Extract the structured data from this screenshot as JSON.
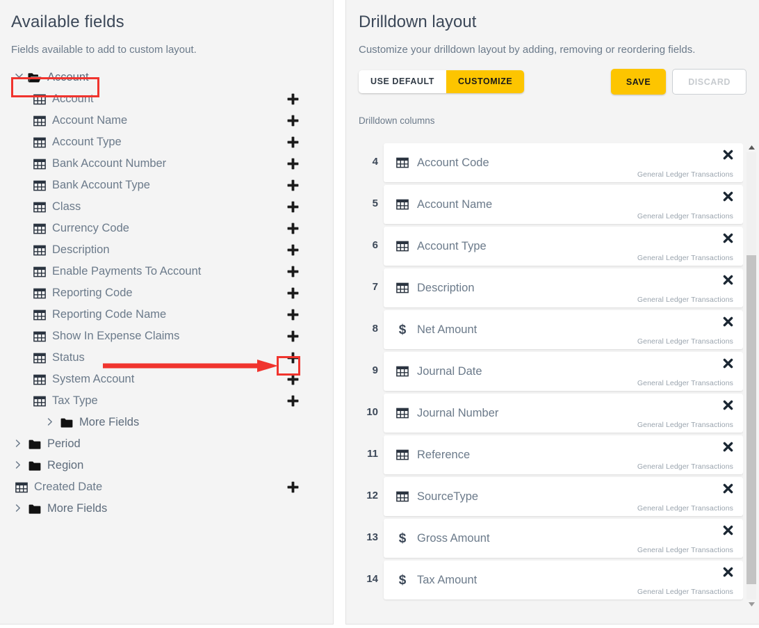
{
  "left": {
    "title": "Available fields",
    "subtitle": "Fields available to add to custom layout.",
    "tree": [
      {
        "label": "Account",
        "type": "folder-open",
        "indent": 0,
        "expanded": true,
        "add": false,
        "highlight": true
      },
      {
        "label": "Account",
        "type": "field",
        "indent": 1,
        "add": true
      },
      {
        "label": "Account Name",
        "type": "field",
        "indent": 1,
        "add": true
      },
      {
        "label": "Account Type",
        "type": "field",
        "indent": 1,
        "add": true
      },
      {
        "label": "Bank Account Number",
        "type": "field",
        "indent": 1,
        "add": true
      },
      {
        "label": "Bank Account Type",
        "type": "field",
        "indent": 1,
        "add": true
      },
      {
        "label": "Class",
        "type": "field",
        "indent": 1,
        "add": true
      },
      {
        "label": "Currency Code",
        "type": "field",
        "indent": 1,
        "add": true
      },
      {
        "label": "Description",
        "type": "field",
        "indent": 1,
        "add": true
      },
      {
        "label": "Enable Payments To Account",
        "type": "field",
        "indent": 1,
        "add": true
      },
      {
        "label": "Reporting Code",
        "type": "field",
        "indent": 1,
        "add": true
      },
      {
        "label": "Reporting Code Name",
        "type": "field",
        "indent": 1,
        "add": true
      },
      {
        "label": "Show In Expense Claims",
        "type": "field",
        "indent": 1,
        "add": true
      },
      {
        "label": "Status",
        "type": "field",
        "indent": 1,
        "add": true,
        "arrow": true
      },
      {
        "label": "System Account",
        "type": "field",
        "indent": 1,
        "add": true
      },
      {
        "label": "Tax Type",
        "type": "field",
        "indent": 1,
        "add": true
      },
      {
        "label": "More Fields",
        "type": "folder-closed",
        "indent": 2,
        "expanded": false,
        "add": false
      },
      {
        "label": "Period",
        "type": "folder-closed",
        "indent": 0,
        "expanded": false,
        "add": false
      },
      {
        "label": "Region",
        "type": "folder-closed",
        "indent": 0,
        "expanded": false,
        "add": false
      },
      {
        "label": "Created Date",
        "type": "field",
        "indent": 0,
        "add": true
      },
      {
        "label": "More Fields",
        "type": "folder-closed",
        "indent": 0,
        "expanded": false,
        "add": false
      }
    ]
  },
  "right": {
    "title": "Drilldown layout",
    "subtitle": "Customize your drilldown layout by adding, removing or reordering fields.",
    "mode_buttons": {
      "use_default": "USE DEFAULT",
      "customize": "CUSTOMIZE",
      "active": "CUSTOMIZE"
    },
    "actions": {
      "save": "SAVE",
      "discard": "DISCARD"
    },
    "columns_label": "Drilldown columns",
    "columns": [
      {
        "num": "4",
        "name": "Account Code",
        "icon": "table-icon",
        "source": "General Ledger Transactions"
      },
      {
        "num": "5",
        "name": "Account Name",
        "icon": "table-icon",
        "source": "General Ledger Transactions"
      },
      {
        "num": "6",
        "name": "Account Type",
        "icon": "table-icon",
        "source": "General Ledger Transactions"
      },
      {
        "num": "7",
        "name": "Description",
        "icon": "table-icon",
        "source": "General Ledger Transactions"
      },
      {
        "num": "8",
        "name": "Net Amount",
        "icon": "dollar-icon",
        "source": "General Ledger Transactions"
      },
      {
        "num": "9",
        "name": "Journal Date",
        "icon": "table-icon",
        "source": "General Ledger Transactions"
      },
      {
        "num": "10",
        "name": "Journal Number",
        "icon": "table-icon",
        "source": "General Ledger Transactions"
      },
      {
        "num": "11",
        "name": "Reference",
        "icon": "table-icon",
        "source": "General Ledger Transactions"
      },
      {
        "num": "12",
        "name": "SourceType",
        "icon": "table-icon",
        "source": "General Ledger Transactions"
      },
      {
        "num": "13",
        "name": "Gross Amount",
        "icon": "dollar-icon",
        "source": "General Ledger Transactions"
      },
      {
        "num": "14",
        "name": "Tax Amount",
        "icon": "dollar-icon",
        "source": "General Ledger Transactions"
      }
    ]
  },
  "colors": {
    "accent_yellow": "#fdc500",
    "annotation_red": "#f0342e",
    "text_primary": "#3c4858",
    "text_secondary": "#6b7a8a",
    "panel_bg": "#f4f4f4"
  }
}
